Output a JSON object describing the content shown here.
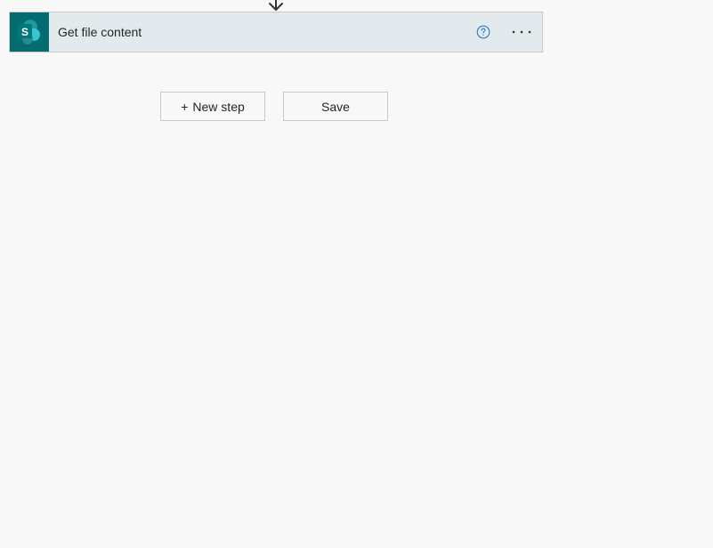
{
  "colors": {
    "canvas_background": "#f8f8f8",
    "card_header_background": "#e3eaed",
    "sharepoint_brand": "#036c70",
    "help_icon_blue": "#2e7bbf",
    "border": "#c8c8c8"
  },
  "connector": {
    "icon": "arrow-down-icon"
  },
  "action_card": {
    "connector_icon": "sharepoint-icon",
    "connector_icon_letter": "S",
    "title": "Get file content",
    "help_icon": "question-mark-icon",
    "more_icon": "ellipsis-icon"
  },
  "buttons": {
    "new_step_plus": "+",
    "new_step_label": "New step",
    "save_label": "Save"
  }
}
